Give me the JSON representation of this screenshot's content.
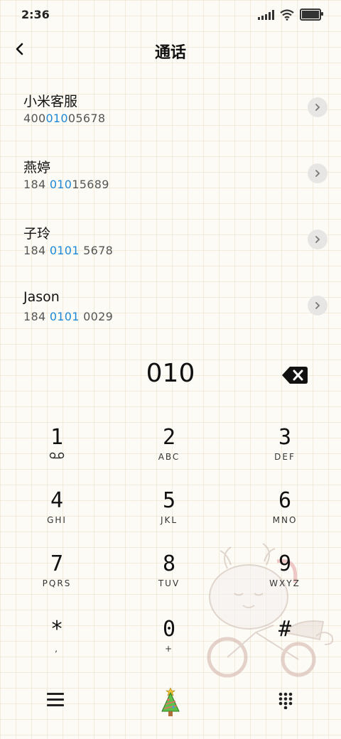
{
  "status_bar": {
    "time": "2:36"
  },
  "header": {
    "title": "通话"
  },
  "contacts": [
    {
      "name": "小米客服",
      "number_parts": [
        "400",
        "010",
        "05678"
      ]
    },
    {
      "name": "燕婷",
      "number_parts": [
        "184 ",
        "010",
        "15689"
      ]
    },
    {
      "name": "子玲",
      "number_parts": [
        "184 ",
        "0101",
        " 5678"
      ]
    },
    {
      "name": "Jason",
      "number_parts": [
        "184 ",
        "0101",
        " 0029"
      ]
    }
  ],
  "dialer": {
    "typed": "010"
  },
  "keypad": [
    {
      "digit": "1",
      "letters": ""
    },
    {
      "digit": "2",
      "letters": "ABC"
    },
    {
      "digit": "3",
      "letters": "DEF"
    },
    {
      "digit": "4",
      "letters": "GHI"
    },
    {
      "digit": "5",
      "letters": "JKL"
    },
    {
      "digit": "6",
      "letters": "MNO"
    },
    {
      "digit": "7",
      "letters": "PQRS"
    },
    {
      "digit": "8",
      "letters": "TUV"
    },
    {
      "digit": "9",
      "letters": "WXYZ"
    },
    {
      "digit": "*",
      "letters": ","
    },
    {
      "digit": "0",
      "letters": "+"
    },
    {
      "digit": "#",
      "letters": ""
    }
  ],
  "icons": {
    "back": "back-arrow-icon",
    "chevron": "chevron-right-icon",
    "backspace": "backspace-icon",
    "voicemail": "voicemail-icon",
    "menu": "menu-icon",
    "tree": "christmas-tree-icon",
    "dialpad": "dialpad-icon"
  },
  "colors": {
    "highlight": "#1e88d6",
    "text": "#111111",
    "background": "#fdfbf5"
  }
}
